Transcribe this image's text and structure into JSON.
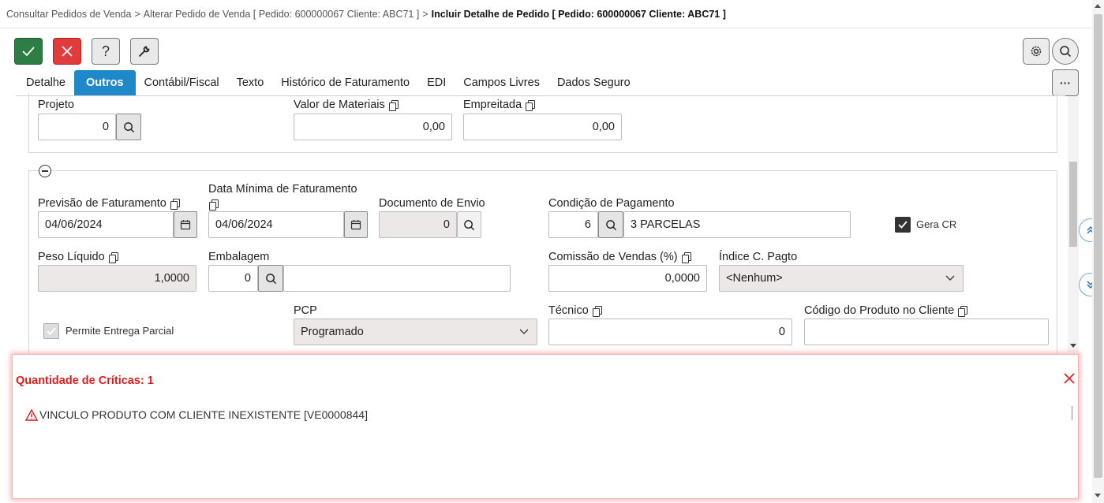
{
  "breadcrumb": {
    "item1": "Consultar Pedidos de Venda",
    "item2": "Alterar Pedido de Venda [ Pedido: 600000067 Cliente: ABC71 ]",
    "current": "Incluir Detalhe de Pedido [ Pedido: 600000067 Cliente: ABC71 ]",
    "separator": ">"
  },
  "toolbar": {
    "confirm_icon": "check-icon",
    "cancel_icon": "close-icon",
    "help_label": "?",
    "tools_icon": "wrench-icon",
    "settings_icon": "gear-icon",
    "search_icon": "search-icon",
    "more_label": "···"
  },
  "tabs": [
    "Detalhe",
    "Outros",
    "Contábil/Fiscal",
    "Texto",
    "Histórico de Faturamento",
    "EDI",
    "Campos Livres",
    "Dados Seguro"
  ],
  "active_tab": "Outros",
  "section1": {
    "projeto_label": "Projeto",
    "projeto_value": "0",
    "valor_materiais_label": "Valor de Materiais",
    "valor_materiais_value": "0,00",
    "empreitada_label": "Empreitada",
    "empreitada_value": "0,00"
  },
  "section2": {
    "previsao_label": "Previsão de Faturamento",
    "previsao_value": "04/06/2024",
    "data_minima_label": "Data Mínima de Faturamento",
    "data_minima_value": "04/06/2024",
    "documento_envio_label": "Documento de Envio",
    "documento_envio_value": "0",
    "condicao_pagamento_label": "Condição de Pagamento",
    "condicao_pagamento_code": "6",
    "condicao_pagamento_desc": "3 PARCELAS",
    "gera_cr_label": "Gera CR",
    "gera_cr_checked": true,
    "peso_liquido_label": "Peso Líquido",
    "peso_liquido_value": "1,0000",
    "embalagem_label": "Embalagem",
    "embalagem_value": "0",
    "embalagem_desc": "",
    "comissao_label": "Comissão de Vendas (%)",
    "comissao_value": "0,0000",
    "indice_label": "Índice C. Pagto",
    "indice_value": "<Nenhum>",
    "permite_entrega_label": "Permite Entrega Parcial",
    "permite_entrega_checked": true,
    "pcp_label": "PCP",
    "pcp_value": "Programado",
    "tecnico_label": "Técnico",
    "tecnico_value": "0",
    "codigo_produto_label": "Código do Produto no Cliente",
    "codigo_produto_value": ""
  },
  "errors": {
    "title": "Quantidade de Críticas: 1",
    "message": "VINCULO PRODUTO COM CLIENTE INEXISTENTE [VE0000844]",
    "icon": "warning-icon"
  },
  "colors": {
    "accent": "#1e88c8",
    "confirm": "#2e7d44",
    "cancel": "#e23b3b",
    "error": "#e01b1b"
  }
}
